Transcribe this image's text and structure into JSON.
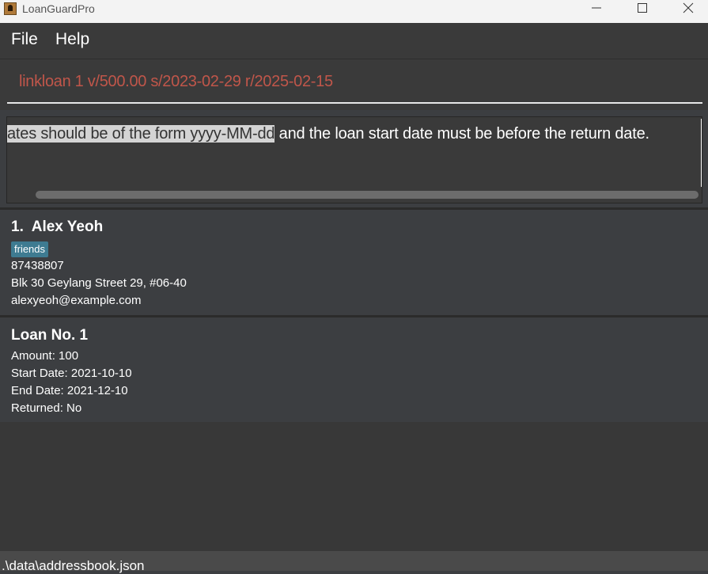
{
  "window": {
    "title": "LoanGuardPro",
    "icon": "app-person-icon"
  },
  "menu": {
    "items": [
      {
        "label": "File"
      },
      {
        "label": "Help"
      }
    ]
  },
  "command_box": {
    "value": "linkloan 1 v/500.00 s/2023-02-29 r/2025-02-15",
    "text_color": "#c0564a"
  },
  "result_display": {
    "selected_text": "ates should be of the form yyyy-MM-dd",
    "rest_text": " and the loan start date must be before the return date."
  },
  "person": {
    "index": "1.",
    "name": "Alex Yeoh",
    "tags": [
      "friends"
    ],
    "phone": "87438807",
    "address": "Blk 30 Geylang Street 29, #06-40",
    "email": "alexyeoh@example.com"
  },
  "loan": {
    "title": "Loan No. 1",
    "amount": "Amount: 100",
    "start_date": "Start Date: 2021-10-10",
    "end_date": "End Date: 2021-12-10",
    "returned": "Returned: No"
  },
  "status_bar": {
    "path": ".\\data\\addressbook.json"
  },
  "colors": {
    "background": "#3c3e41",
    "tag": "#3e7b91",
    "error_text": "#c0564a"
  }
}
